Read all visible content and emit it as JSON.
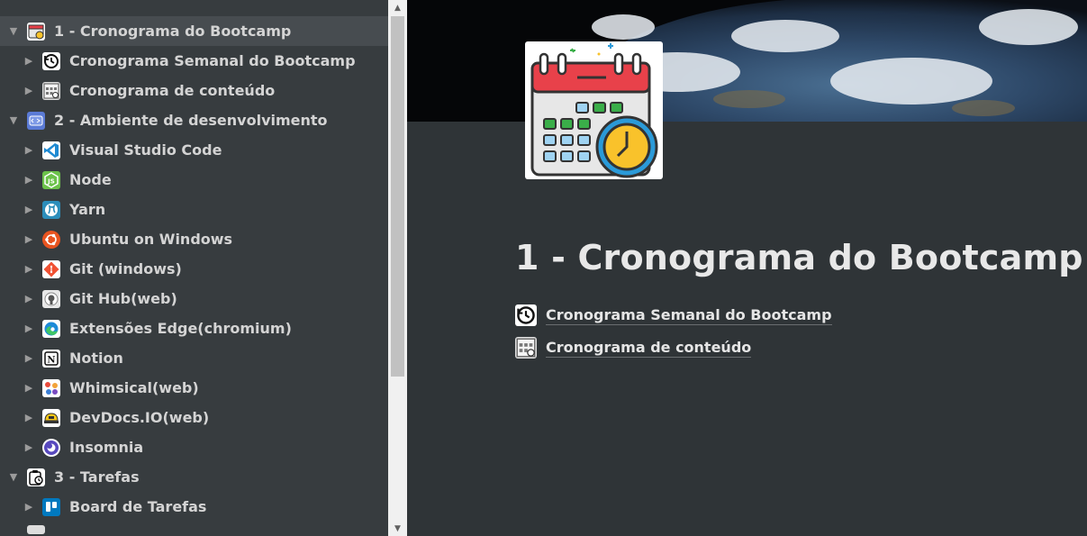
{
  "sidebar": {
    "items": [
      {
        "label": "1 - Cronograma do Bootcamp"
      },
      {
        "label": "Cronograma Semanal do Bootcamp"
      },
      {
        "label": "Cronograma de conteúdo"
      },
      {
        "label": "2 - Ambiente de desenvolvimento"
      },
      {
        "label": "Visual Studio Code"
      },
      {
        "label": "Node"
      },
      {
        "label": "Yarn"
      },
      {
        "label": "Ubuntu on Windows"
      },
      {
        "label": "Git (windows)"
      },
      {
        "label": "Git Hub(web)"
      },
      {
        "label": "Extensões Edge(chromium)"
      },
      {
        "label": "Notion"
      },
      {
        "label": "Whimsical(web)"
      },
      {
        "label": "DevDocs.IO(web)"
      },
      {
        "label": "Insomnia"
      },
      {
        "label": "3 - Tarefas"
      },
      {
        "label": "Board de Tarefas"
      }
    ]
  },
  "page": {
    "title": "1 - Cronograma do Bootcamp",
    "links": [
      {
        "label": "Cronograma Semanal do Bootcamp"
      },
      {
        "label": "Cronograma de conteúdo"
      }
    ]
  },
  "colors": {
    "sidebar_bg": "#373c3f",
    "main_bg": "#2f3437",
    "selected_row": "#474c50",
    "calendar_red": "#e8414a",
    "clock_yellow": "#f9c22b",
    "grid_blue": "#9fd3f2",
    "check_green": "#3aae49"
  }
}
